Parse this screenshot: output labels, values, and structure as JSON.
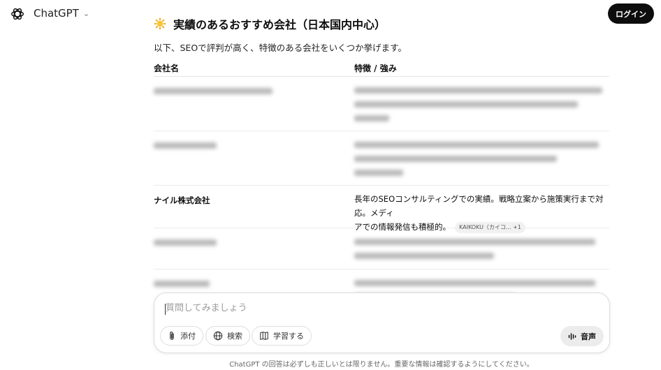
{
  "header": {
    "app_name": "ChatGPT",
    "login_label": "ログイン"
  },
  "message": {
    "heading": "実績のあるおすすめ会社（日本国内中心）",
    "intro": "以下、SEOで評判が高く、特徴のある会社をいくつか挙げます。",
    "table": {
      "columns": [
        "会社名",
        "特徴 / 強み"
      ],
      "visible_row": {
        "company": "ナイル株式会社",
        "desc_line1": "長年のSEOコンサルティングでの実績。戦略立案から施策実行まで対応。メディ",
        "desc_line2": "アでの情報発信も積極的。",
        "source_badge": "KAIKOKU（カイコ... +1"
      },
      "blurred_rows": 4
    }
  },
  "composer": {
    "placeholder": "質問してみましょう",
    "attach_label": "添付",
    "search_label": "検索",
    "study_label": "学習する",
    "voice_label": "音声"
  },
  "footer": {
    "disclaimer": "ChatGPT の回答は必ずしも正しいとは限りません。重要な情報は確認するようにしてください。"
  },
  "icons": [
    "openai-logo-icon",
    "chevron-down-icon",
    "sun-emoji-icon",
    "paperclip-icon",
    "globe-icon",
    "book-icon",
    "voice-wave-icon"
  ]
}
